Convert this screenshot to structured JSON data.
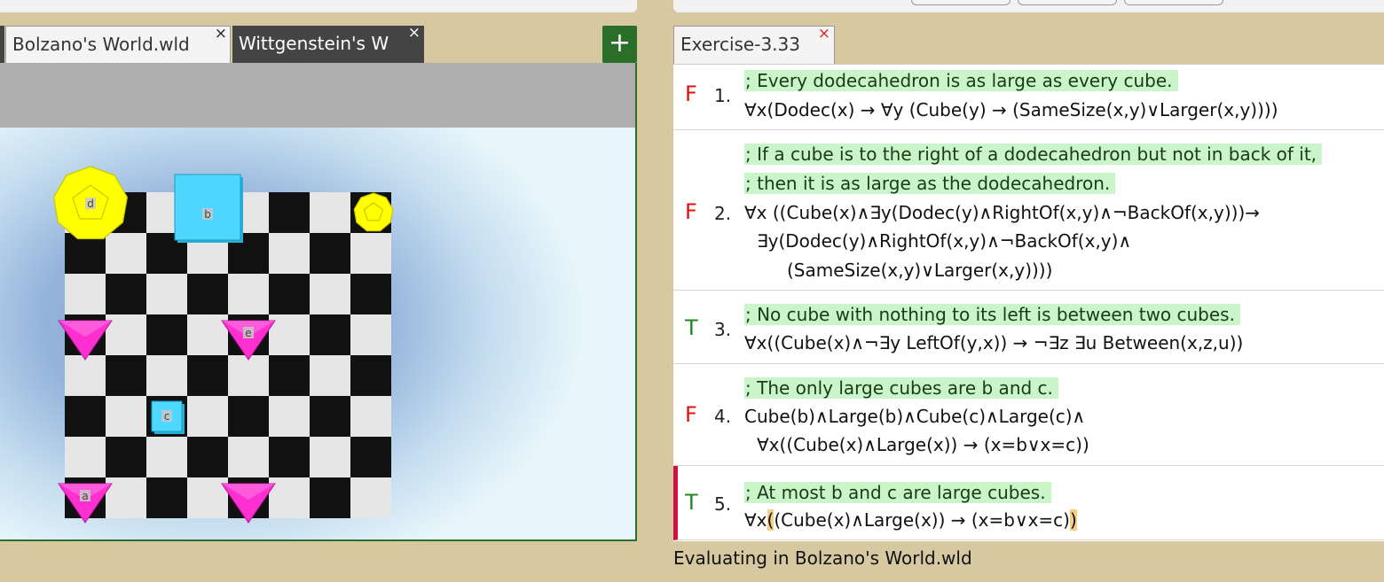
{
  "world_tabs": [
    {
      "label": "Bolzano's World.wld",
      "active": true,
      "close": "×"
    },
    {
      "label": "Wittgenstein's W",
      "active": false,
      "close": "×"
    }
  ],
  "add_tab_label": "+",
  "world": {
    "grid_size": 8,
    "objects": [
      {
        "name": "d",
        "shape": "dodec",
        "size": "large",
        "col": 0,
        "row": 0
      },
      {
        "name": "b",
        "shape": "cube",
        "size": "large",
        "col": 3,
        "row": 0
      },
      {
        "name": "",
        "shape": "dodec",
        "size": "small",
        "col": 7,
        "row": 0
      },
      {
        "name": "",
        "shape": "tet",
        "size": "small",
        "col": 0,
        "row": 3
      },
      {
        "name": "e",
        "shape": "tet",
        "size": "small",
        "col": 4,
        "row": 3
      },
      {
        "name": "c",
        "shape": "cube",
        "size": "small",
        "col": 2,
        "row": 5
      },
      {
        "name": "a",
        "shape": "tet",
        "size": "small",
        "col": 0,
        "row": 7
      },
      {
        "name": "",
        "shape": "tet",
        "size": "small",
        "col": 4,
        "row": 7
      }
    ],
    "colors": {
      "dodec": "#ffff00",
      "cube": "#4fd8ff",
      "tet": "#ff2fd0",
      "dark": "#111111",
      "light": "#e6e6e6"
    }
  },
  "exercise_tab": {
    "label": "Exercise-3.33",
    "close": "×"
  },
  "sentences": [
    {
      "number": "1.",
      "value": "F",
      "lines": [
        {
          "text": "; Every dodecahedron is as large as every cube.",
          "comment": true,
          "indent": 0
        },
        {
          "text": "∀x(Dodec(x) → ∀y (Cube(y) → (SameSize(x,y)∨Larger(x,y))))",
          "comment": false,
          "indent": 0
        }
      ]
    },
    {
      "number": "2.",
      "value": "F",
      "lines": [
        {
          "text": "; If a cube is to the right of a dodecahedron but not in back of it,",
          "comment": true,
          "indent": 0
        },
        {
          "text": "; then it is as large as the dodecahedron.",
          "comment": true,
          "indent": 0
        },
        {
          "text": "∀x ((Cube(x)∧∃y(Dodec(y)∧RightOf(x,y)∧¬BackOf(x,y)))→",
          "comment": false,
          "indent": 0
        },
        {
          "text": "∃y(Dodec(y)∧RightOf(x,y)∧¬BackOf(x,y)∧",
          "comment": false,
          "indent": 14
        },
        {
          "text": "(SameSize(x,y)∨Larger(x,y))))",
          "comment": false,
          "indent": 48
        }
      ]
    },
    {
      "number": "3.",
      "value": "T",
      "lines": [
        {
          "text": "; No cube with nothing to its left is between two cubes.",
          "comment": true,
          "indent": 0
        },
        {
          "text": "∀x((Cube(x)∧¬∃y LeftOf(y,x))  →  ¬∃z ∃u Between(x,z,u))",
          "comment": false,
          "indent": 0
        }
      ]
    },
    {
      "number": "4.",
      "value": "F",
      "lines": [
        {
          "text": "; The only large cubes are b and c.",
          "comment": true,
          "indent": 0
        },
        {
          "text": "Cube(b)∧Large(b)∧Cube(c)∧Large(c)∧",
          "comment": false,
          "indent": 0
        },
        {
          "text": "∀x((Cube(x)∧Large(x)) → (x=b∨x=c))",
          "comment": false,
          "indent": 14
        }
      ]
    },
    {
      "number": "5.",
      "value": "T",
      "selected": true,
      "lines": [
        {
          "text": "; At most b and c are large cubes.",
          "comment": true,
          "indent": 0
        },
        {
          "text": "∀x((Cube(x)∧Large(x)) → (x=b∨x=c))",
          "comment": false,
          "indent": 0,
          "highlight_parens": true
        }
      ]
    }
  ],
  "status": "Evaluating in Bolzano's World.wld"
}
